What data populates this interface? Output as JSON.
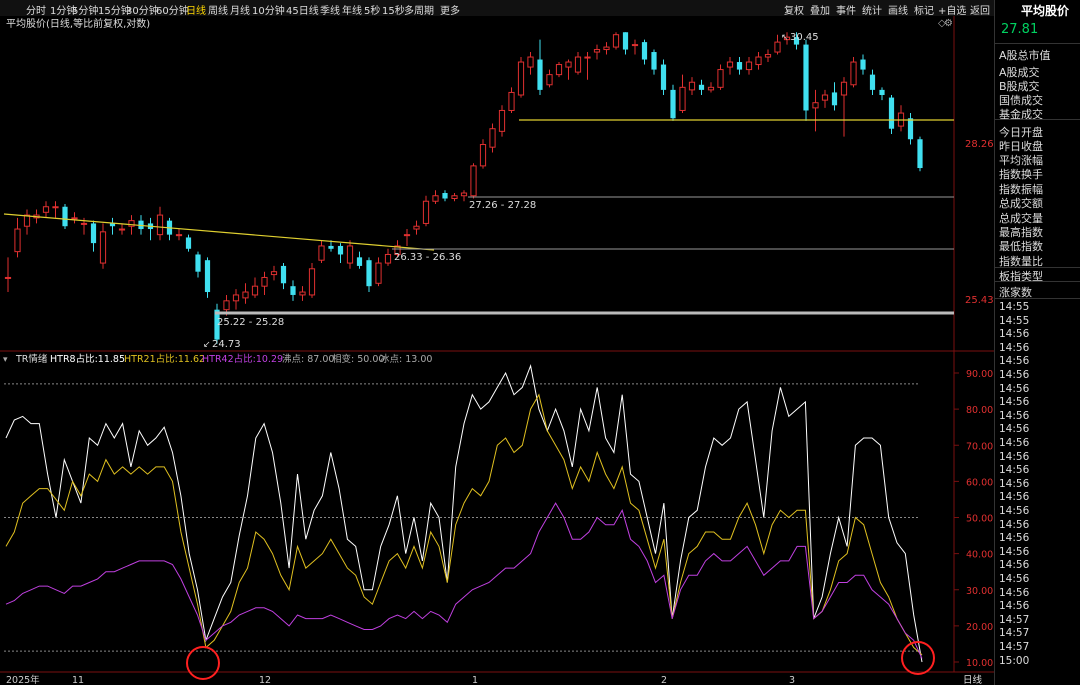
{
  "toolbar": {
    "left": [
      "分时",
      "1分钟",
      "5分钟",
      "15分钟",
      "30分钟",
      "60分钟",
      "日线",
      "周线",
      "月线",
      "10分钟",
      "45日线",
      "季线",
      "年线",
      "5秒",
      "15秒",
      "多周期",
      "更多"
    ],
    "active": "日线",
    "right": [
      "复权",
      "叠加",
      "事件",
      "统计",
      "画线",
      "标记",
      "+自选",
      "返回"
    ]
  },
  "top_chart": {
    "title": "平均股价(日线,等比前复权,对数)",
    "price_labels": [
      "28.26",
      "25.43"
    ],
    "annotations": {
      "high": "30.45",
      "low": "24.73",
      "range1": "25.22 - 25.28",
      "range2": "26.33 - 26.36",
      "range3": "27.26 - 27.28"
    }
  },
  "bottom_chart": {
    "title": "TR情绪",
    "legend": [
      {
        "label": "HTR8占比:",
        "value": "11.85",
        "color": "#ffffff"
      },
      {
        "label": "HTR21占比:",
        "value": "11.62",
        "color": "#e0c020"
      },
      {
        "label": "HTR42占比:",
        "value": "10.29",
        "color": "#c040e0"
      }
    ],
    "params": [
      "沸点: 87.00",
      "相变: 50.00",
      "冰点: 13.00"
    ],
    "y_ticks": [
      "90.00",
      "80.00",
      "70.00",
      "60.00",
      "50.00",
      "40.00",
      "30.00",
      "20.00",
      "10.00"
    ]
  },
  "x_axis": {
    "labels": [
      "2025年",
      "11",
      "12",
      "1",
      "2",
      "3"
    ],
    "period_label": "日线"
  },
  "right_panel": {
    "title": "平均股价",
    "price": "27.81",
    "items": [
      "A股总市值",
      "A股成交",
      "B股成交",
      "国债成交",
      "基金成交",
      "今日开盘",
      "昨日收盘",
      "平均涨幅",
      "指数换手",
      "指数振幅",
      "总成交额",
      "总成交量",
      "最高指数",
      "最低指数",
      "指数量比",
      "板指类型",
      "涨家数"
    ],
    "times": [
      "14:55",
      "14:55",
      "14:56",
      "14:56",
      "14:56",
      "14:56",
      "14:56",
      "14:56",
      "14:56",
      "14:56",
      "14:56",
      "14:56",
      "14:56",
      "14:56",
      "14:56",
      "14:56",
      "14:56",
      "14:56",
      "14:56",
      "14:56",
      "14:56",
      "14:56",
      "14:56",
      "14:57",
      "14:57",
      "14:57",
      "15:00"
    ]
  },
  "colors": {
    "up": "#e03030",
    "down": "#40e0f0",
    "htr8": "#ffffff",
    "htr21": "#e0c020",
    "htr42": "#c040e0",
    "trend": "#e0d030",
    "circle": "#ff2020"
  },
  "chart_data": [
    {
      "type": "candlestick",
      "title": "平均股价(日线,等比前复权,对数)",
      "x_labels": [
        "2025年",
        "11",
        "12",
        "1",
        "2",
        "3"
      ],
      "y_labels_visible": [
        25.43,
        28.26
      ],
      "notable": {
        "high": 30.45,
        "low": 24.73
      },
      "candles": [
        {
          "o": 25.85,
          "c": 25.85,
          "h": 26.2,
          "l": 25.6
        },
        {
          "o": 26.3,
          "c": 26.7,
          "h": 26.9,
          "l": 26.2
        },
        {
          "o": 26.75,
          "c": 26.95,
          "h": 27.05,
          "l": 26.6
        },
        {
          "o": 26.9,
          "c": 26.95,
          "h": 27.05,
          "l": 26.8
        },
        {
          "o": 27.0,
          "c": 27.1,
          "h": 27.2,
          "l": 26.9
        },
        {
          "o": 27.1,
          "c": 27.1,
          "h": 27.2,
          "l": 26.9
        },
        {
          "o": 27.1,
          "c": 26.75,
          "h": 27.15,
          "l": 26.7
        },
        {
          "o": 26.9,
          "c": 26.9,
          "h": 27.0,
          "l": 26.8
        },
        {
          "o": 26.8,
          "c": 26.8,
          "h": 26.9,
          "l": 26.6
        },
        {
          "o": 26.8,
          "c": 26.45,
          "h": 26.85,
          "l": 26.3
        },
        {
          "o": 26.1,
          "c": 26.65,
          "h": 26.8,
          "l": 26.0
        },
        {
          "o": 26.8,
          "c": 26.75,
          "h": 26.9,
          "l": 26.6
        },
        {
          "o": 26.7,
          "c": 26.7,
          "h": 26.8,
          "l": 26.6
        },
        {
          "o": 26.75,
          "c": 26.85,
          "h": 26.95,
          "l": 26.6
        },
        {
          "o": 26.85,
          "c": 26.7,
          "h": 26.95,
          "l": 26.6
        },
        {
          "o": 26.8,
          "c": 26.7,
          "h": 26.9,
          "l": 26.5
        },
        {
          "o": 26.6,
          "c": 26.95,
          "h": 27.1,
          "l": 26.5
        },
        {
          "o": 26.85,
          "c": 26.6,
          "h": 26.9,
          "l": 26.5
        },
        {
          "o": 26.6,
          "c": 26.6,
          "h": 26.7,
          "l": 26.5
        },
        {
          "o": 26.55,
          "c": 26.35,
          "h": 26.6,
          "l": 26.3
        },
        {
          "o": 26.25,
          "c": 25.95,
          "h": 26.3,
          "l": 25.85
        },
        {
          "o": 26.15,
          "c": 25.6,
          "h": 26.2,
          "l": 25.5
        },
        {
          "o": 25.3,
          "c": 24.8,
          "h": 25.4,
          "l": 24.73
        },
        {
          "o": 25.3,
          "c": 25.45,
          "h": 25.55,
          "l": 25.2
        },
        {
          "o": 25.45,
          "c": 25.55,
          "h": 25.65,
          "l": 25.3
        },
        {
          "o": 25.5,
          "c": 25.6,
          "h": 25.75,
          "l": 25.4
        },
        {
          "o": 25.55,
          "c": 25.7,
          "h": 25.85,
          "l": 25.5
        },
        {
          "o": 25.7,
          "c": 25.85,
          "h": 25.95,
          "l": 25.55
        },
        {
          "o": 25.9,
          "c": 25.95,
          "h": 26.05,
          "l": 25.8
        },
        {
          "o": 26.05,
          "c": 25.75,
          "h": 26.1,
          "l": 25.65
        },
        {
          "o": 25.7,
          "c": 25.55,
          "h": 25.8,
          "l": 25.45
        },
        {
          "o": 25.55,
          "c": 25.6,
          "h": 25.7,
          "l": 25.45
        },
        {
          "o": 25.55,
          "c": 26.0,
          "h": 26.1,
          "l": 25.5
        },
        {
          "o": 26.15,
          "c": 26.4,
          "h": 26.5,
          "l": 26.1
        },
        {
          "o": 26.4,
          "c": 26.35,
          "h": 26.5,
          "l": 26.3
        },
        {
          "o": 26.4,
          "c": 26.25,
          "h": 26.45,
          "l": 26.1
        },
        {
          "o": 26.1,
          "c": 26.4,
          "h": 26.5,
          "l": 26.0
        },
        {
          "o": 26.2,
          "c": 26.05,
          "h": 26.3,
          "l": 26.0
        },
        {
          "o": 26.15,
          "c": 25.7,
          "h": 26.2,
          "l": 25.6
        },
        {
          "o": 25.75,
          "c": 26.1,
          "h": 26.2,
          "l": 25.7
        },
        {
          "o": 26.1,
          "c": 26.25,
          "h": 26.35,
          "l": 26.05
        },
        {
          "o": 26.25,
          "c": 26.4,
          "h": 26.5,
          "l": 26.2
        },
        {
          "o": 26.6,
          "c": 26.6,
          "h": 26.7,
          "l": 26.4
        },
        {
          "o": 26.7,
          "c": 26.75,
          "h": 26.85,
          "l": 26.6
        },
        {
          "o": 26.8,
          "c": 27.2,
          "h": 27.3,
          "l": 26.75
        },
        {
          "o": 27.2,
          "c": 27.3,
          "h": 27.4,
          "l": 27.15
        },
        {
          "o": 27.35,
          "c": 27.25,
          "h": 27.4,
          "l": 27.2
        },
        {
          "o": 27.25,
          "c": 27.3,
          "h": 27.35,
          "l": 27.2
        },
        {
          "o": 27.3,
          "c": 27.35,
          "h": 27.4,
          "l": 27.2
        },
        {
          "o": 27.3,
          "c": 27.85,
          "h": 27.9,
          "l": 27.25
        },
        {
          "o": 27.85,
          "c": 28.25,
          "h": 28.35,
          "l": 27.8
        },
        {
          "o": 28.2,
          "c": 28.55,
          "h": 28.65,
          "l": 28.1
        },
        {
          "o": 28.5,
          "c": 28.9,
          "h": 29.0,
          "l": 28.4
        },
        {
          "o": 28.9,
          "c": 29.25,
          "h": 29.35,
          "l": 28.85
        },
        {
          "o": 29.2,
          "c": 29.85,
          "h": 29.95,
          "l": 29.15
        },
        {
          "o": 29.75,
          "c": 29.95,
          "h": 30.05,
          "l": 29.6
        },
        {
          "o": 29.9,
          "c": 29.3,
          "h": 30.3,
          "l": 29.2
        },
        {
          "o": 29.4,
          "c": 29.6,
          "h": 29.7,
          "l": 29.35
        },
        {
          "o": 29.6,
          "c": 29.8,
          "h": 29.85,
          "l": 29.55
        },
        {
          "o": 29.75,
          "c": 29.85,
          "h": 29.9,
          "l": 29.5
        },
        {
          "o": 29.65,
          "c": 29.95,
          "h": 30.05,
          "l": 29.6
        },
        {
          "o": 29.95,
          "c": 29.95,
          "h": 30.05,
          "l": 29.5
        },
        {
          "o": 30.05,
          "c": 30.1,
          "h": 30.2,
          "l": 29.9
        },
        {
          "o": 30.1,
          "c": 30.15,
          "h": 30.25,
          "l": 30.0
        },
        {
          "o": 30.15,
          "c": 30.4,
          "h": 30.45,
          "l": 30.1
        },
        {
          "o": 30.45,
          "c": 30.1,
          "h": 30.45,
          "l": 30.0
        },
        {
          "o": 30.2,
          "c": 30.2,
          "h": 30.3,
          "l": 30.0
        },
        {
          "o": 30.25,
          "c": 29.9,
          "h": 30.3,
          "l": 29.8
        },
        {
          "o": 30.05,
          "c": 29.7,
          "h": 30.1,
          "l": 29.6
        },
        {
          "o": 29.8,
          "c": 29.3,
          "h": 29.9,
          "l": 29.2
        },
        {
          "o": 29.3,
          "c": 28.75,
          "h": 29.4,
          "l": 28.7
        },
        {
          "o": 28.9,
          "c": 29.35,
          "h": 29.6,
          "l": 28.85
        },
        {
          "o": 29.3,
          "c": 29.45,
          "h": 29.55,
          "l": 29.2
        },
        {
          "o": 29.4,
          "c": 29.3,
          "h": 29.5,
          "l": 29.2
        },
        {
          "o": 29.3,
          "c": 29.35,
          "h": 29.45,
          "l": 29.25
        },
        {
          "o": 29.35,
          "c": 29.7,
          "h": 29.8,
          "l": 29.3
        },
        {
          "o": 29.75,
          "c": 29.85,
          "h": 29.95,
          "l": 29.6
        },
        {
          "o": 29.85,
          "c": 29.7,
          "h": 29.95,
          "l": 29.6
        },
        {
          "o": 29.7,
          "c": 29.85,
          "h": 29.95,
          "l": 29.6
        },
        {
          "o": 29.8,
          "c": 29.95,
          "h": 30.05,
          "l": 29.7
        },
        {
          "o": 29.95,
          "c": 30.0,
          "h": 30.1,
          "l": 29.85
        },
        {
          "o": 30.05,
          "c": 30.25,
          "h": 30.4,
          "l": 30.0
        },
        {
          "o": 30.3,
          "c": 30.35,
          "h": 30.45,
          "l": 30.2
        },
        {
          "o": 30.35,
          "c": 30.2,
          "h": 30.45,
          "l": 30.1
        },
        {
          "o": 30.2,
          "c": 28.9,
          "h": 30.3,
          "l": 28.7
        },
        {
          "o": 28.95,
          "c": 29.05,
          "h": 29.3,
          "l": 28.5
        },
        {
          "o": 29.1,
          "c": 29.2,
          "h": 29.3,
          "l": 28.95
        },
        {
          "o": 29.25,
          "c": 29.0,
          "h": 29.45,
          "l": 28.9
        },
        {
          "o": 29.2,
          "c": 29.45,
          "h": 29.55,
          "l": 28.4
        },
        {
          "o": 29.4,
          "c": 29.85,
          "h": 29.95,
          "l": 29.35
        },
        {
          "o": 29.9,
          "c": 29.7,
          "h": 30.0,
          "l": 29.6
        },
        {
          "o": 29.6,
          "c": 29.3,
          "h": 29.7,
          "l": 29.2
        },
        {
          "o": 29.3,
          "c": 29.2,
          "h": 29.35,
          "l": 29.1
        },
        {
          "o": 29.15,
          "c": 28.55,
          "h": 29.2,
          "l": 28.45
        },
        {
          "o": 28.6,
          "c": 28.85,
          "h": 29.0,
          "l": 28.5
        },
        {
          "o": 28.75,
          "c": 28.35,
          "h": 28.85,
          "l": 28.25
        },
        {
          "o": 28.35,
          "c": 27.81,
          "h": 28.4,
          "l": 27.75
        }
      ]
    },
    {
      "type": "line",
      "title": "TR情绪",
      "ylim": [
        8,
        96
      ],
      "y_ticks": [
        10,
        20,
        30,
        40,
        50,
        60,
        70,
        80,
        90
      ],
      "reference_lines": [
        87,
        50,
        13
      ],
      "series": [
        {
          "name": "HTR8占比",
          "values": [
            72,
            77,
            78,
            76,
            76,
            62,
            50,
            66,
            60,
            54,
            72,
            70,
            76,
            72,
            76,
            64,
            74,
            70,
            72,
            75,
            68,
            56,
            40,
            30,
            16,
            22,
            28,
            32,
            45,
            56,
            72,
            76,
            68,
            54,
            36,
            62,
            44,
            52,
            56,
            68,
            58,
            44,
            42,
            30,
            30,
            42,
            48,
            56,
            40,
            50,
            38,
            54,
            50,
            32,
            64,
            76,
            84,
            80,
            82,
            86,
            90,
            84,
            86,
            92,
            80,
            74,
            80,
            74,
            64,
            80,
            74,
            86,
            72,
            68,
            84,
            62,
            60,
            50,
            40,
            54,
            22,
            38,
            50,
            52,
            64,
            72,
            70,
            72,
            80,
            82,
            66,
            50,
            74,
            86,
            78,
            80,
            82,
            22,
            28,
            40,
            50,
            42,
            70,
            72,
            72,
            70,
            50,
            43,
            40,
            23,
            10
          ]
        },
        {
          "name": "HTR21占比",
          "values": [
            42,
            46,
            54,
            56,
            58,
            58,
            55,
            52,
            60,
            56,
            62,
            60,
            66,
            62,
            64,
            62,
            64,
            62,
            64,
            64,
            60,
            46,
            36,
            26,
            14,
            16,
            20,
            24,
            32,
            36,
            46,
            44,
            40,
            34,
            30,
            42,
            36,
            38,
            40,
            44,
            40,
            36,
            34,
            28,
            26,
            32,
            38,
            40,
            36,
            42,
            36,
            46,
            42,
            32,
            48,
            54,
            58,
            56,
            60,
            70,
            72,
            68,
            70,
            80,
            84,
            74,
            70,
            66,
            58,
            64,
            60,
            68,
            62,
            58,
            64,
            54,
            52,
            44,
            36,
            44,
            22,
            32,
            40,
            42,
            46,
            46,
            44,
            44,
            50,
            54,
            48,
            40,
            48,
            52,
            50,
            52,
            52,
            22,
            24,
            30,
            38,
            40,
            50,
            48,
            40,
            32,
            28,
            22,
            18,
            14,
            12
          ]
        },
        {
          "name": "HTR42占比",
          "values": [
            26,
            27,
            29,
            30,
            31,
            31,
            30,
            29,
            31,
            31,
            32,
            33,
            35,
            35,
            36,
            37,
            38,
            38,
            38,
            38,
            37,
            33,
            28,
            23,
            16,
            18,
            20,
            21,
            23,
            24,
            25,
            25,
            24,
            22,
            20,
            23,
            22,
            22,
            22,
            23,
            22,
            21,
            20,
            19,
            19,
            20,
            22,
            23,
            22,
            24,
            22,
            24,
            23,
            21,
            26,
            28,
            30,
            31,
            32,
            34,
            36,
            36,
            38,
            40,
            46,
            50,
            54,
            50,
            44,
            44,
            46,
            50,
            48,
            48,
            52,
            44,
            42,
            38,
            32,
            34,
            22,
            30,
            34,
            34,
            38,
            40,
            38,
            38,
            40,
            42,
            38,
            34,
            36,
            38,
            38,
            42,
            42,
            22,
            24,
            28,
            32,
            32,
            34,
            34,
            30,
            28,
            26,
            22,
            18,
            16,
            11
          ]
        }
      ]
    }
  ]
}
